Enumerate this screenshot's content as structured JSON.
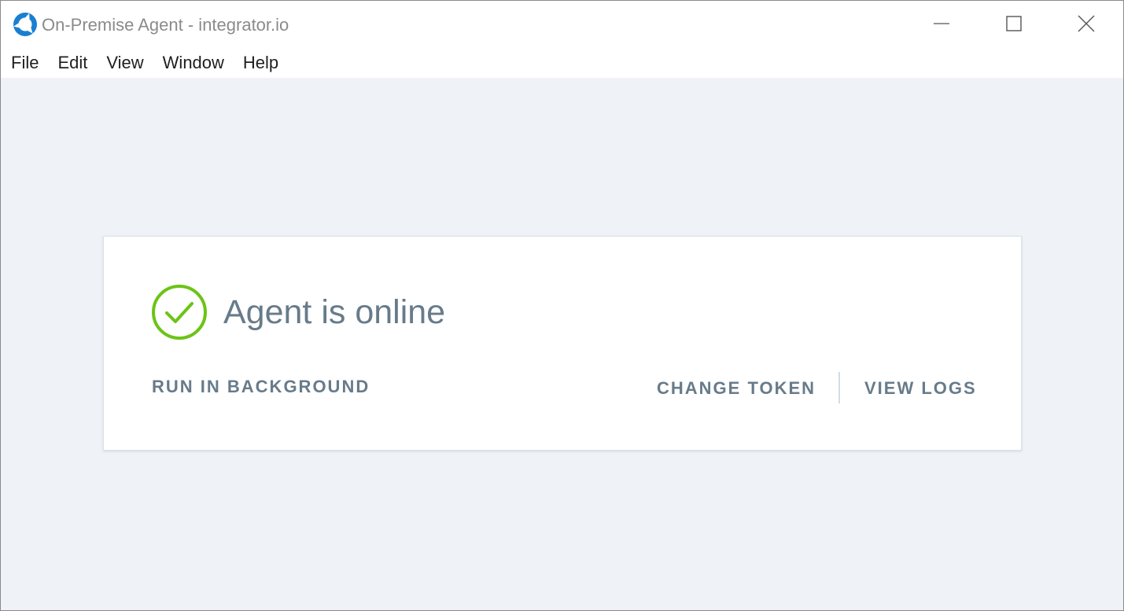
{
  "window": {
    "title": "On-Premise Agent - integrator.io",
    "app_icon": "integrator-io-logo",
    "controls": {
      "minimize_icon": "minimize-icon",
      "maximize_icon": "maximize-icon",
      "close_icon": "close-icon"
    }
  },
  "menubar": {
    "items": [
      "File",
      "Edit",
      "View",
      "Window",
      "Help"
    ]
  },
  "status": {
    "icon": "check-circle-icon",
    "icon_color": "#6cc417",
    "text": "Agent is online"
  },
  "actions": {
    "run_in_background": "RUN IN BACKGROUND",
    "change_token": "CHANGE TOKEN",
    "view_logs": "VIEW LOGS"
  },
  "colors": {
    "accent_blue": "#1a7fd1",
    "text_gray": "#677b8a",
    "background": "#eff3f7"
  }
}
